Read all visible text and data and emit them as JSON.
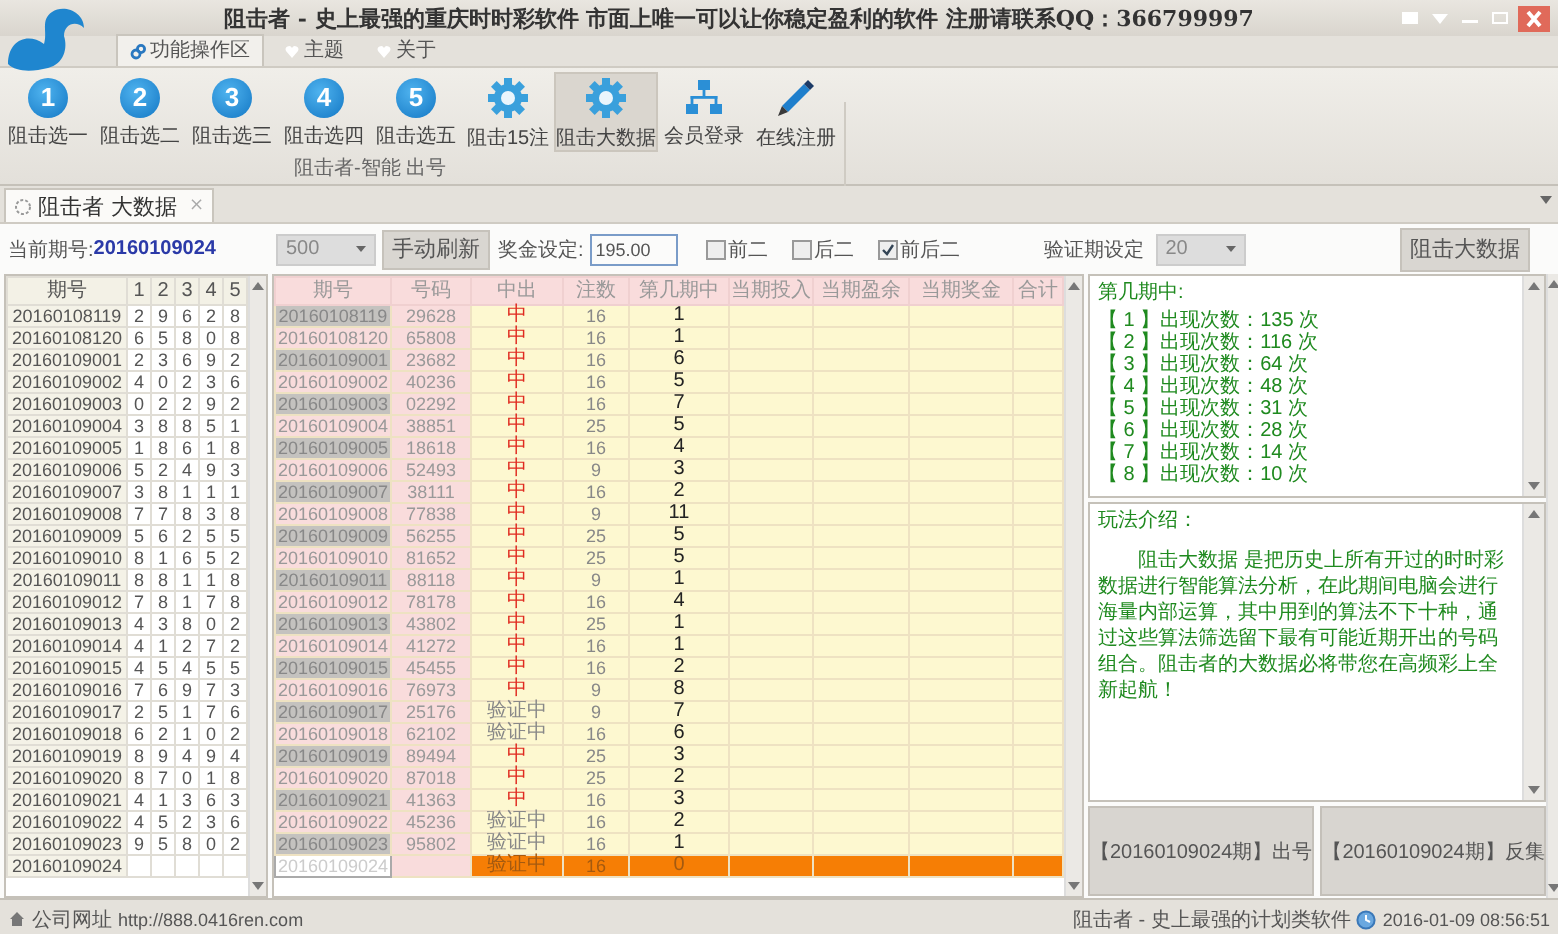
{
  "window": {
    "title": "阻击者 - 史上最强的重庆时时彩软件 市面上唯一可以让你稳定盈利的软件 注册请联系QQ：366799997"
  },
  "ribbon_tabs": [
    {
      "label": "功能操作区",
      "selected": true
    },
    {
      "label": "主题",
      "selected": false
    },
    {
      "label": "关于",
      "selected": false
    }
  ],
  "ribbon_buttons": [
    {
      "kind": "number",
      "icon_text": "1",
      "label": "阻击选一",
      "selected": false
    },
    {
      "kind": "number",
      "icon_text": "2",
      "label": "阻击选二",
      "selected": false
    },
    {
      "kind": "number",
      "icon_text": "3",
      "label": "阻击选三",
      "selected": false
    },
    {
      "kind": "number",
      "icon_text": "4",
      "label": "阻击选四",
      "selected": false
    },
    {
      "kind": "number",
      "icon_text": "5",
      "label": "阻击选五",
      "selected": false
    },
    {
      "kind": "gear",
      "label": "阻击15注",
      "selected": false
    },
    {
      "kind": "gear",
      "label": "阻击大数据",
      "selected": true
    },
    {
      "kind": "network",
      "label": "会员登录",
      "selected": false
    },
    {
      "kind": "pencil",
      "label": "在线注册",
      "selected": false
    }
  ],
  "ribbon_group": "阻击者-智能 出号",
  "doc_tabs": [
    {
      "label": "阻击者 大数据",
      "close": "×",
      "selected": true
    }
  ],
  "toolbar": {
    "period_label": "当前期号:",
    "period_value": "20160109024",
    "count_select": "500",
    "refresh_button": "手动刷新",
    "prize_label": "奖金设定:",
    "prize_value": "195.00",
    "options": [
      {
        "label": "前二",
        "checked": false
      },
      {
        "label": "后二",
        "checked": false
      },
      {
        "label": "前后二",
        "checked": true
      }
    ],
    "verify_label": "验证期设定",
    "verify_select": "20",
    "run_button": "阻击大数据"
  },
  "history_table": {
    "columns": [
      "期号",
      "1",
      "2",
      "3",
      "4",
      "5"
    ],
    "rows": [
      {
        "period": "20160108119",
        "digits": [
          "2",
          "9",
          "6",
          "2",
          "8"
        ]
      },
      {
        "period": "20160108120",
        "digits": [
          "6",
          "5",
          "8",
          "0",
          "8"
        ]
      },
      {
        "period": "20160109001",
        "digits": [
          "2",
          "3",
          "6",
          "9",
          "2"
        ]
      },
      {
        "period": "20160109002",
        "digits": [
          "4",
          "0",
          "2",
          "3",
          "6"
        ]
      },
      {
        "period": "20160109003",
        "digits": [
          "0",
          "2",
          "2",
          "9",
          "2"
        ]
      },
      {
        "period": "20160109004",
        "digits": [
          "3",
          "8",
          "8",
          "5",
          "1"
        ]
      },
      {
        "period": "20160109005",
        "digits": [
          "1",
          "8",
          "6",
          "1",
          "8"
        ]
      },
      {
        "period": "20160109006",
        "digits": [
          "5",
          "2",
          "4",
          "9",
          "3"
        ]
      },
      {
        "period": "20160109007",
        "digits": [
          "3",
          "8",
          "1",
          "1",
          "1"
        ]
      },
      {
        "period": "20160109008",
        "digits": [
          "7",
          "7",
          "8",
          "3",
          "8"
        ]
      },
      {
        "period": "20160109009",
        "digits": [
          "5",
          "6",
          "2",
          "5",
          "5"
        ]
      },
      {
        "period": "20160109010",
        "digits": [
          "8",
          "1",
          "6",
          "5",
          "2"
        ]
      },
      {
        "period": "20160109011",
        "digits": [
          "8",
          "8",
          "1",
          "1",
          "8"
        ]
      },
      {
        "period": "20160109012",
        "digits": [
          "7",
          "8",
          "1",
          "7",
          "8"
        ]
      },
      {
        "period": "20160109013",
        "digits": [
          "4",
          "3",
          "8",
          "0",
          "2"
        ]
      },
      {
        "period": "20160109014",
        "digits": [
          "4",
          "1",
          "2",
          "7",
          "2"
        ]
      },
      {
        "period": "20160109015",
        "digits": [
          "4",
          "5",
          "4",
          "5",
          "5"
        ]
      },
      {
        "period": "20160109016",
        "digits": [
          "7",
          "6",
          "9",
          "7",
          "3"
        ]
      },
      {
        "period": "20160109017",
        "digits": [
          "2",
          "5",
          "1",
          "7",
          "6"
        ]
      },
      {
        "period": "20160109018",
        "digits": [
          "6",
          "2",
          "1",
          "0",
          "2"
        ]
      },
      {
        "period": "20160109019",
        "digits": [
          "8",
          "9",
          "4",
          "9",
          "4"
        ]
      },
      {
        "period": "20160109020",
        "digits": [
          "8",
          "7",
          "0",
          "1",
          "8"
        ]
      },
      {
        "period": "20160109021",
        "digits": [
          "4",
          "1",
          "3",
          "6",
          "3"
        ]
      },
      {
        "period": "20160109022",
        "digits": [
          "4",
          "5",
          "2",
          "3",
          "6"
        ]
      },
      {
        "period": "20160109023",
        "digits": [
          "9",
          "5",
          "8",
          "0",
          "2"
        ]
      },
      {
        "period": "20160109024",
        "digits": []
      }
    ]
  },
  "plan_table": {
    "columns": [
      "期号",
      "号码",
      "中出",
      "注数",
      "第几期中",
      "当期投入",
      "当期盈余",
      "当期奖金",
      "合计"
    ],
    "rows": [
      {
        "period": "20160108119",
        "code": "29628",
        "result": "中",
        "hit": true,
        "bets": "16",
        "round": "1",
        "selected": false
      },
      {
        "period": "20160108120",
        "code": "65808",
        "result": "中",
        "hit": true,
        "bets": "16",
        "round": "1",
        "selected": false
      },
      {
        "period": "20160109001",
        "code": "23682",
        "result": "中",
        "hit": true,
        "bets": "16",
        "round": "6",
        "selected": false
      },
      {
        "period": "20160109002",
        "code": "40236",
        "result": "中",
        "hit": true,
        "bets": "16",
        "round": "5",
        "selected": false
      },
      {
        "period": "20160109003",
        "code": "02292",
        "result": "中",
        "hit": true,
        "bets": "16",
        "round": "7",
        "selected": false
      },
      {
        "period": "20160109004",
        "code": "38851",
        "result": "中",
        "hit": true,
        "bets": "25",
        "round": "5",
        "selected": false
      },
      {
        "period": "20160109005",
        "code": "18618",
        "result": "中",
        "hit": true,
        "bets": "16",
        "round": "4",
        "selected": false
      },
      {
        "period": "20160109006",
        "code": "52493",
        "result": "中",
        "hit": true,
        "bets": "9",
        "round": "3",
        "selected": false
      },
      {
        "period": "20160109007",
        "code": "38111",
        "result": "中",
        "hit": true,
        "bets": "16",
        "round": "2",
        "selected": false
      },
      {
        "period": "20160109008",
        "code": "77838",
        "result": "中",
        "hit": true,
        "bets": "9",
        "round": "11",
        "selected": false
      },
      {
        "period": "20160109009",
        "code": "56255",
        "result": "中",
        "hit": true,
        "bets": "25",
        "round": "5",
        "selected": false
      },
      {
        "period": "20160109010",
        "code": "81652",
        "result": "中",
        "hit": true,
        "bets": "25",
        "round": "5",
        "selected": false
      },
      {
        "period": "20160109011",
        "code": "88118",
        "result": "中",
        "hit": true,
        "bets": "9",
        "round": "1",
        "selected": false
      },
      {
        "period": "20160109012",
        "code": "78178",
        "result": "中",
        "hit": true,
        "bets": "16",
        "round": "4",
        "selected": false
      },
      {
        "period": "20160109013",
        "code": "43802",
        "result": "中",
        "hit": true,
        "bets": "25",
        "round": "1",
        "selected": false
      },
      {
        "period": "20160109014",
        "code": "41272",
        "result": "中",
        "hit": true,
        "bets": "16",
        "round": "1",
        "selected": false
      },
      {
        "period": "20160109015",
        "code": "45455",
        "result": "中",
        "hit": true,
        "bets": "16",
        "round": "2",
        "selected": false
      },
      {
        "period": "20160109016",
        "code": "76973",
        "result": "中",
        "hit": true,
        "bets": "9",
        "round": "8",
        "selected": false
      },
      {
        "period": "20160109017",
        "code": "25176",
        "result": "验证中",
        "hit": false,
        "bets": "9",
        "round": "7",
        "selected": false
      },
      {
        "period": "20160109018",
        "code": "62102",
        "result": "验证中",
        "hit": false,
        "bets": "16",
        "round": "6",
        "selected": false
      },
      {
        "period": "20160109019",
        "code": "89494",
        "result": "中",
        "hit": true,
        "bets": "25",
        "round": "3",
        "selected": false
      },
      {
        "period": "20160109020",
        "code": "87018",
        "result": "中",
        "hit": true,
        "bets": "25",
        "round": "2",
        "selected": false
      },
      {
        "period": "20160109021",
        "code": "41363",
        "result": "中",
        "hit": true,
        "bets": "16",
        "round": "3",
        "selected": false
      },
      {
        "period": "20160109022",
        "code": "45236",
        "result": "验证中",
        "hit": false,
        "bets": "16",
        "round": "2",
        "selected": false
      },
      {
        "period": "20160109023",
        "code": "95802",
        "result": "验证中",
        "hit": false,
        "bets": "16",
        "round": "1",
        "selected": false
      },
      {
        "period": "20160109024",
        "result": "验证中",
        "hit": false,
        "bets": "16",
        "round": "0",
        "selected": true
      }
    ]
  },
  "stats": {
    "title": "第几期中:",
    "lines": [
      "【 1 】出现次数：135 次",
      "【 2 】出现次数：116 次",
      "【 3 】出现次数：64 次",
      "【 4 】出现次数：48 次",
      "【 5 】出现次数：31 次",
      "【 6 】出现次数：28 次",
      "【 7 】出现次数：14 次",
      "【 8 】出现次数：10 次"
    ]
  },
  "intro": {
    "title": "玩法介绍：",
    "text": "阻击大数据 是把历史上所有开过的时时彩数据进行智能算法分析，在此期间电脑会进行海量内部运算，其中用到的算法不下十种，通过这些算法筛选留下最有可能近期开出的号码组合。阻击者的大数据必将带您在高频彩上全新起航！"
  },
  "action_buttons": [
    "【20160109024期】出号",
    "【20160109024期】反集"
  ],
  "status_bar": {
    "site_label": "公司网址",
    "site_url": "http://888.0416ren.com",
    "slogan": "阻击者 - 史上最强的计划类软件",
    "datetime": "2016-01-09 08:56:51"
  }
}
